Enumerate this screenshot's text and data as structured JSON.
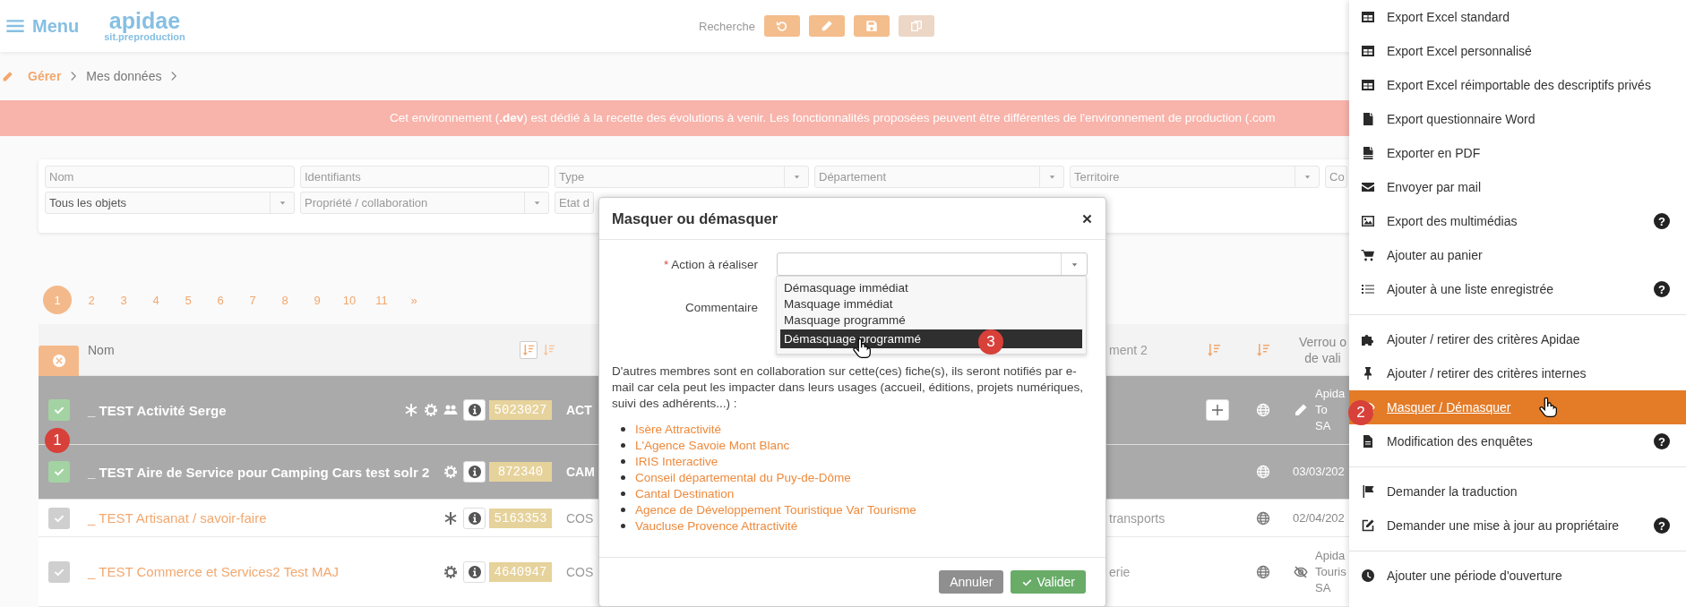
{
  "header": {
    "menu_label": "Menu",
    "logo": "apidae",
    "logo_sub": "sit.preproduction",
    "search_label": "Recherche",
    "toolbar": [
      {
        "kind": "undo",
        "disabled": false
      },
      {
        "kind": "pencil",
        "disabled": false
      },
      {
        "kind": "save",
        "disabled": false
      },
      {
        "kind": "copy",
        "disabled": true
      }
    ]
  },
  "breadcrumb": [
    {
      "label": "Gérer",
      "kind": "root"
    },
    {
      "label": "Mes données",
      "kind": "page"
    }
  ],
  "banner": "Cet environnement (**.dev**) est dédié à la recette des évolutions à venir. Les fonctionnalités proposées peuvent être différentes de l'environnement de production (.com",
  "filters": {
    "row_1": [
      {
        "placeholder": "Nom",
        "kind": "text"
      },
      {
        "placeholder": "Identifiants",
        "kind": "text"
      },
      {
        "placeholder": "Type",
        "kind": "select"
      },
      {
        "placeholder": "Département",
        "kind": "select"
      },
      {
        "placeholder": "Territoire",
        "kind": "select"
      },
      {
        "placeholder": "Co",
        "kind": "text"
      }
    ],
    "row_2": [
      {
        "value": "Tous les objets",
        "kind": "select"
      },
      {
        "placeholder": "Propriété / collaboration",
        "kind": "select"
      },
      {
        "placeholder": "Etat d",
        "kind": "text"
      }
    ]
  },
  "pagination": {
    "pages": [
      {
        "label": "1",
        "selected": true
      },
      {
        "label": "2",
        "selected": false
      },
      {
        "label": "3",
        "selected": false
      },
      {
        "label": "4",
        "selected": false
      },
      {
        "label": "5",
        "selected": false
      },
      {
        "label": "6",
        "selected": false
      },
      {
        "label": "7",
        "selected": false
      },
      {
        "label": "8",
        "selected": false
      },
      {
        "label": "9",
        "selected": false
      },
      {
        "label": "10",
        "selected": false
      },
      {
        "label": "11",
        "selected": false
      }
    ],
    "next": "»"
  },
  "table": {
    "columns": [
      {
        "label": "Nom"
      },
      {
        "label": "ment 2"
      },
      {
        "label": "Verrou o\nde vali"
      }
    ],
    "rows": [
      {
        "selected": true,
        "name": "_ TEST Activité Serge",
        "flags": [
          {
            "kind": "asterisk"
          },
          {
            "kind": "gear"
          },
          {
            "kind": "group"
          }
        ],
        "id": "5023027",
        "type": "ACT",
        "add_button": true,
        "verrou": {
          "kind": "edited",
          "text": "Apida\nTo\nSA"
        }
      },
      {
        "selected": true,
        "name": "_ TEST Aire de Service pour Camping Cars test solr 2",
        "flags": [
          {
            "kind": "gear"
          }
        ],
        "id": "872340",
        "type": "CAM",
        "add_button": false,
        "verrou": {
          "kind": "date",
          "text": "03/03/202"
        }
      },
      {
        "selected": false,
        "name": "_ TEST Artisanat / savoir-faire",
        "flags": [
          {
            "kind": "asterisk"
          }
        ],
        "id": "5163353",
        "type": "COS",
        "column_2": "transports",
        "add_button": false,
        "verrou": {
          "kind": "date",
          "text": "02/04/202"
        }
      },
      {
        "selected": false,
        "name": "_ TEST Commerce et Services2 Test MAJ",
        "flags": [
          {
            "kind": "gear"
          }
        ],
        "id": "4640947",
        "type": "COS",
        "column_2": "erie",
        "add_button": false,
        "verrou": {
          "kind": "hidden",
          "text": "Apida\nTouris\nSA"
        }
      }
    ]
  },
  "modal": {
    "title": "Masquer ou démasquer",
    "action_field": {
      "required_mark": "*",
      "label": "Action à réaliser"
    },
    "comment_label": "Commentaire",
    "dropdown_options": [
      {
        "label": "Démasquage immédiat",
        "selected": false
      },
      {
        "label": "Masquage immédiat",
        "selected": false
      },
      {
        "label": "Masquage programmé",
        "selected": false
      },
      {
        "label": "Démasquage programmé",
        "selected": true
      }
    ],
    "notice": "D'autres membres sont en collaboration sur cette(ces) fiche(s), ils seront notifiés par e-mail car cela peut les impacter dans leurs usages (accueil, éditions, projets numériques, suivi des adhérents...) :",
    "members": [
      "Isère Attractivité",
      "L'Agence Savoie Mont Blanc",
      "IRIS Interactive",
      "Conseil départemental du Puy-de-Dôme",
      "Cantal Destination",
      "Agence de Développement Touristique Var Tourisme",
      "Vaucluse Provence Attractivité"
    ],
    "buttons": [
      {
        "label": "Annuler",
        "kind": "cancel"
      },
      {
        "label": "Valider",
        "kind": "confirm"
      }
    ]
  },
  "menu": {
    "sections": [
      {
        "items": [
          {
            "label": "Export Excel standard",
            "kind": "table",
            "selected": false
          },
          {
            "label": "Export Excel personnalisé",
            "kind": "table",
            "selected": false
          },
          {
            "label": "Export Excel réimportable des descriptifs privés",
            "kind": "table",
            "selected": false
          },
          {
            "label": "Export questionnaire Word",
            "kind": "word",
            "selected": false
          },
          {
            "label": "Exporter en PDF",
            "kind": "pdf",
            "selected": false
          },
          {
            "label": "Envoyer par mail",
            "kind": "mail",
            "selected": false
          },
          {
            "label": "Export des multimédias",
            "kind": "image",
            "selected": false,
            "help": "?"
          },
          {
            "label": "Ajouter au panier",
            "kind": "cart",
            "selected": false
          },
          {
            "label": "Ajouter à une liste enregistrée",
            "kind": "list",
            "selected": false,
            "help": "?"
          }
        ]
      },
      {
        "items": [
          {
            "label": "Ajouter / retirer des critères Apidae",
            "kind": "puzzle",
            "selected": false
          },
          {
            "label": "Ajouter / retirer des critères internes",
            "kind": "pin",
            "selected": false
          },
          {
            "label": "Masquer / Démasquer",
            "kind": "visibility",
            "selected": true
          },
          {
            "label": "Modification des enquêtes",
            "kind": "file",
            "selected": false,
            "help": "?"
          }
        ]
      },
      {
        "items": [
          {
            "label": "Demander la traduction",
            "kind": "flag",
            "selected": false
          },
          {
            "label": "Demander une mise à jour au propriétaire",
            "kind": "edit",
            "selected": false,
            "help": "?"
          }
        ]
      },
      {
        "items": [
          {
            "label": "Ajouter une période d'ouverture",
            "kind": "clock",
            "selected": false
          }
        ]
      }
    ]
  },
  "step_badges": [
    {
      "label": "1"
    },
    {
      "label": "2"
    },
    {
      "label": "3"
    }
  ]
}
